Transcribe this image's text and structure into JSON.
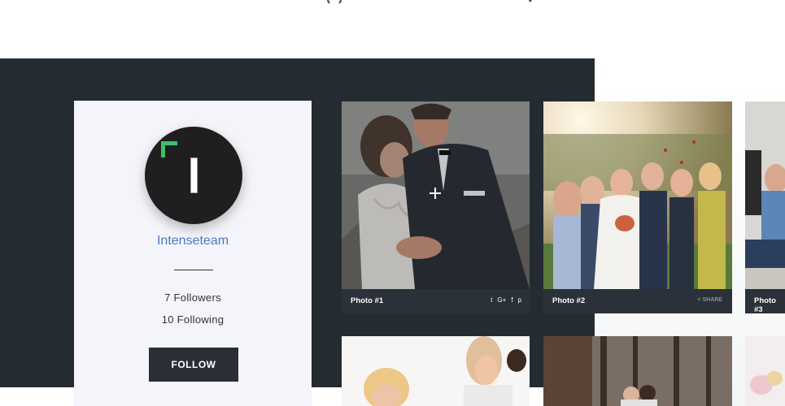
{
  "profile": {
    "username": "Intenseteam",
    "followers": "7 Followers",
    "following": "10 Following",
    "follow_button": "FOLLOW"
  },
  "photos": [
    {
      "title": "Photo #1",
      "social": [
        "t",
        "G+",
        "f",
        "p"
      ]
    },
    {
      "title": "Photo #2",
      "share": "SHARE"
    },
    {
      "title": "Photo #3"
    }
  ],
  "colors": {
    "dark_band": "#252c31",
    "card_bg": "#f3f5fa",
    "accent_blue": "#4a78c2",
    "avatar_accent": "#3cc06a"
  }
}
